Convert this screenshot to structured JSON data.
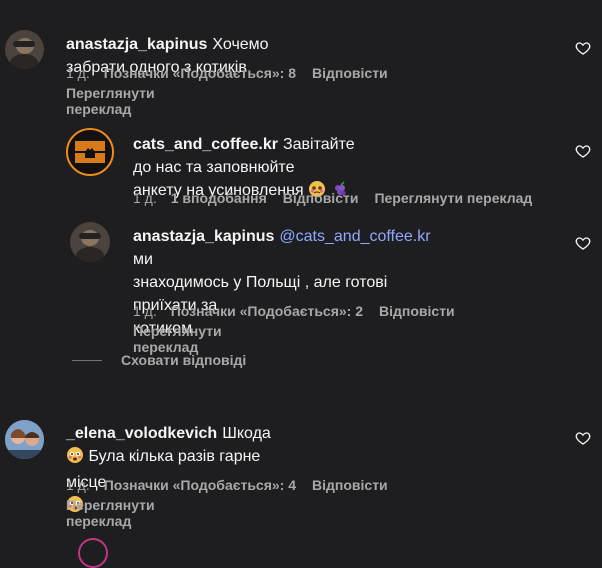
{
  "comments": [
    {
      "username": "anastazja_kapinus",
      "text": "Хочемо забрати одного з котиків",
      "time": "1 д.",
      "likes": "Позначки «Подобається»: 8",
      "reply": "Відповісти",
      "translate": "Переглянути переклад"
    },
    {
      "username": "cats_and_coffee.kr",
      "text_line1": "Завітайте до нас та заповнюйте",
      "text_line2": "анкету на усиновлення",
      "time": "1 д.",
      "likes": "1 вподобання",
      "reply": "Відповісти",
      "translate": "Переглянути переклад"
    },
    {
      "username": "anastazja_kapinus",
      "mention": "@cats_and_coffee.kr",
      "text_line1": "ми",
      "text_line2": "знаходимось у Польщі , але готові приїхати за",
      "text_line3": "котиком",
      "time": "1 д.",
      "likes": "Позначки «Подобається»: 2",
      "reply": "Відповісти",
      "translate": "Переглянути переклад"
    },
    {
      "username": "_elena_volodkevich",
      "text_line1": "Шкода",
      "text_line2": "Була кілька разів гарне місце",
      "time": "1 д.",
      "likes": "Позначки «Подобається»: 4",
      "reply": "Відповісти",
      "translate": "Переглянути переклад"
    }
  ],
  "hide_replies": "Сховати відповіді",
  "colors": {
    "background": "#1e1e21",
    "text": "#f5f5f5",
    "muted": "#a8a8a8",
    "link": "#8fa9ff"
  },
  "icons": [
    "heart-icon",
    "cry-face-emoji",
    "grape-emoji",
    "fearful-face-emoji"
  ]
}
